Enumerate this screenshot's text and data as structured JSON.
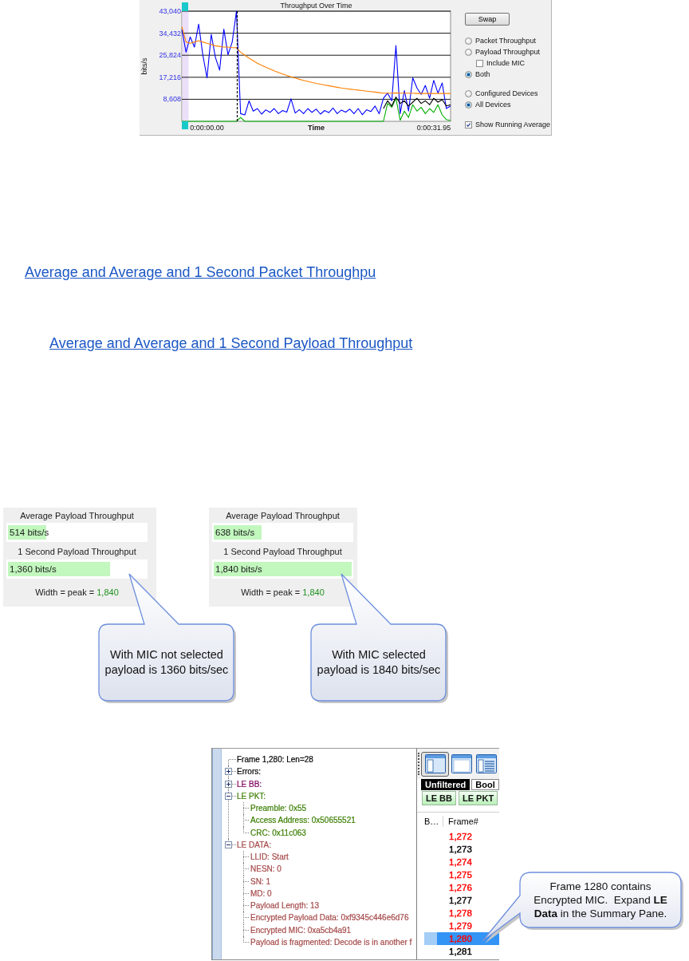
{
  "throughput_panel": {
    "chart_data": {
      "type": "line",
      "title": "Throughput Over Time",
      "xlabel": "Time",
      "ylabel": "bits/s",
      "grid": true,
      "categories": [
        null,
        null,
        null,
        null,
        null,
        null,
        "0:00:00.00",
        null,
        null,
        null,
        null,
        null,
        null,
        null,
        null,
        null,
        null,
        null,
        null,
        null,
        null,
        null,
        null,
        null,
        null,
        null,
        null,
        null,
        null,
        null,
        null,
        null,
        null,
        null,
        null,
        null,
        null,
        null,
        null,
        null,
        null,
        null,
        null,
        null,
        null,
        null,
        null,
        null,
        null,
        null,
        null,
        null,
        null,
        null,
        null,
        null,
        null,
        null,
        null,
        null,
        "0:00:31.95",
        null,
        null,
        null,
        null
      ],
      "series": [
        {
          "color": "#0000ff",
          "values": [
            36000,
            27000,
            33000,
            29000,
            38000,
            26000,
            17000,
            34000,
            25000,
            20000,
            36000,
            26000,
            31000,
            43000,
            3000,
            2500,
            8000,
            4000,
            5000,
            2800,
            4500,
            3500,
            5000,
            3000,
            4200,
            3600,
            8800,
            3200,
            4600,
            3000,
            5000,
            3500,
            4800,
            2800,
            4200,
            3400,
            5200,
            3000,
            4400,
            3600,
            4800,
            3000,
            5000,
            2600,
            4500,
            3800,
            6000,
            3000,
            9000,
            11000,
            8000,
            29600,
            3000,
            12000,
            4000,
            17000,
            13000,
            10500,
            14000,
            9000,
            16000,
            11000,
            15000,
            5000,
            6000
          ]
        },
        {
          "color": "#00b000",
          "values": [
            0,
            0,
            0,
            0,
            0,
            0,
            0,
            0,
            0,
            0,
            0,
            0,
            0,
            0,
            1500,
            0,
            0,
            0,
            0,
            0,
            0,
            0,
            0,
            0,
            0,
            0,
            0,
            0,
            0,
            0,
            0,
            0,
            0,
            0,
            0,
            0,
            0,
            0,
            0,
            0,
            0,
            0,
            0,
            0,
            0,
            0,
            0,
            0,
            0,
            7000,
            5500,
            9000,
            400,
            4000,
            1500,
            6500,
            4000,
            5500,
            3000,
            5000,
            3500,
            6500,
            2500,
            700,
            300
          ]
        },
        {
          "color": "#000000",
          "values": [
            null,
            null,
            null,
            null,
            null,
            null,
            null,
            null,
            null,
            null,
            null,
            null,
            null,
            null,
            null,
            null,
            null,
            null,
            null,
            null,
            null,
            null,
            null,
            null,
            null,
            null,
            null,
            null,
            null,
            null,
            null,
            null,
            null,
            null,
            null,
            null,
            null,
            null,
            null,
            null,
            null,
            null,
            null,
            null,
            null,
            null,
            null,
            null,
            5000,
            8000,
            6000,
            9500,
            7000,
            8000,
            6000,
            7500,
            9000,
            7000,
            8000,
            6500,
            9000,
            7500,
            8500,
            6000,
            6500
          ]
        },
        {
          "color": "#ff8000",
          "values": [
            37000,
            31000,
            30500,
            31000,
            31500,
            31000,
            30500,
            30000,
            29500,
            29300,
            29000,
            29000,
            28800,
            28800,
            27000,
            25800,
            24700,
            23700,
            22700,
            21900,
            21100,
            20400,
            19700,
            19100,
            18500,
            17900,
            17400,
            16900,
            16400,
            16000,
            15600,
            15200,
            14800,
            14500,
            14200,
            13900,
            13600,
            13300,
            13000,
            12800,
            12600,
            12400,
            12200,
            12000,
            11800,
            11600,
            11400,
            11200,
            11000,
            11000,
            11000,
            11100,
            11000,
            11000,
            11000,
            11000,
            10900,
            10900,
            10900,
            10900,
            10900,
            10900,
            10900,
            10900,
            10900
          ]
        }
      ],
      "ylim": [
        0,
        43040
      ],
      "yticks": [
        {
          "value": 8608,
          "label": "8,608"
        },
        {
          "value": 17216,
          "label": "17,216"
        },
        {
          "value": 25824,
          "label": "25,824"
        },
        {
          "value": 34432,
          "label": "34,432"
        },
        {
          "value": 43040,
          "label": "43,040"
        }
      ]
    },
    "swap_button": "Swap",
    "measure_options": [
      {
        "label": "Packet Throughput",
        "selected": false
      },
      {
        "label": "Payload Throughput",
        "selected": false,
        "sub_option": {
          "label": "Include MIC",
          "checked": false
        }
      },
      {
        "label": "Both",
        "selected": true
      }
    ],
    "device_options": [
      {
        "label": "Configured Devices",
        "selected": false
      },
      {
        "label": "All Devices",
        "selected": true
      }
    ],
    "show_running_average": {
      "label": "Show Running Average",
      "checked": true
    }
  },
  "links": [
    {
      "text": "Average and Average and 1 Second Packet Throughpu"
    },
    {
      "text": "Average and Average and 1 Second Payload Throughput"
    }
  ],
  "meter_panels": [
    {
      "meters": [
        {
          "title": "Average Payload Throughput",
          "reading": "514 bits/s",
          "level": 0.279
        },
        {
          "title": "1 Second Payload Throughput",
          "reading": "1,360 bits/s",
          "level": 0.739
        }
      ],
      "note": "Width = peak =",
      "peak": "1,840",
      "callout": "With MIC not selected\npayload is 1360 bits/sec"
    },
    {
      "meters": [
        {
          "title": "Average Payload Throughput",
          "reading": "638 bits/s",
          "level": 0.347
        },
        {
          "title": "1 Second Payload Throughput",
          "reading": "1,840 bits/s",
          "level": 1
        }
      ],
      "note": "Width = peak =",
      "peak": "1,840",
      "callout": "With MIC selected\npayload is 1840 bits/sec"
    }
  ],
  "capture": {
    "tree": {
      "title": "Frame 1,280:  Len=28",
      "nodes": [
        {
          "label": "Errors:",
          "color": "#000000",
          "expanded": false
        },
        {
          "label": "LE BB:",
          "color": "#800060",
          "expanded": false
        },
        {
          "label": "LE PKT:",
          "color": "#3a7d00",
          "expanded": true,
          "children": [
            {
              "label": "Preamble: 0x55"
            },
            {
              "label": "Access Address: 0x50655521"
            },
            {
              "label": "CRC: 0x11c063"
            }
          ]
        },
        {
          "label": "LE DATA:",
          "color": "#a44848",
          "expanded": true,
          "children": [
            {
              "label": "LLID: Start"
            },
            {
              "label": "NESN: 0"
            },
            {
              "label": "SN: 1"
            },
            {
              "label": "MD: 0"
            },
            {
              "label": "Payload Length: 13"
            },
            {
              "label": "Encrypted Payload Data: 0xf9345c446e6d76"
            },
            {
              "label": "Encrypted MIC: 0xa5cb4a91"
            },
            {
              "label": "Payload is fragmented: Decode is in another f"
            }
          ]
        }
      ]
    },
    "view_buttons": [
      {
        "kind": "split",
        "selected": true
      },
      {
        "kind": "single",
        "selected": false
      },
      {
        "kind": "list",
        "selected": false
      }
    ],
    "filter_tabs": [
      {
        "label": "Unfiltered",
        "selected": true
      },
      {
        "label": "Bool",
        "selected": false
      }
    ],
    "protocol_tabs": [
      "LE BB",
      "LE PKT"
    ],
    "columns": [
      "B…",
      "Frame#"
    ],
    "rows": [
      {
        "frame": "1,272",
        "color": "#ff0000",
        "selected": false
      },
      {
        "frame": "1,273",
        "color": "#000000",
        "selected": false
      },
      {
        "frame": "1,274",
        "color": "#ff0000",
        "selected": false
      },
      {
        "frame": "1,275",
        "color": "#ff0000",
        "selected": false
      },
      {
        "frame": "1,276",
        "color": "#ff0000",
        "selected": false
      },
      {
        "frame": "1,277",
        "color": "#000000",
        "selected": false
      },
      {
        "frame": "1,278",
        "color": "#ff0000",
        "selected": false
      },
      {
        "frame": "1,279",
        "color": "#ff0000",
        "selected": false
      },
      {
        "frame": "1,280",
        "color": "#ff0000",
        "selected": true
      },
      {
        "frame": "1,281",
        "color": "#000000",
        "selected": false
      }
    ],
    "callout": "Frame 1280 contains\nEncrypted MIC.  Expand **LE**\n**Data** in the Summary Pane."
  }
}
